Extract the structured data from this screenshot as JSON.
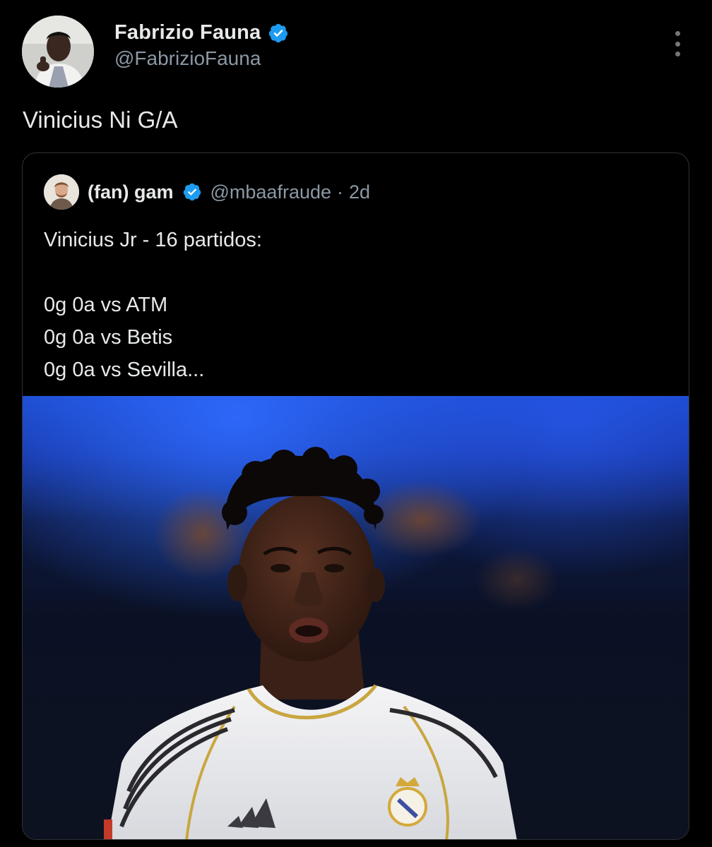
{
  "tweet": {
    "author": {
      "display_name": "Fabrizio Fauna",
      "handle": "@FabrizioFauna",
      "verified": true,
      "avatar_icon": "profile-photo"
    },
    "text": "Vinicius Ni G/A"
  },
  "quoted_tweet": {
    "author": {
      "display_name": "(fan) gam",
      "handle": "@mbaafraude",
      "verified": true,
      "avatar_icon": "profile-photo"
    },
    "separator": "·",
    "time": "2d",
    "lines": [
      "Vinicius Jr - 16 partidos:",
      "",
      "0g 0a vs ATM",
      "0g 0a vs Betis",
      "0g 0a vs Sevilla..."
    ],
    "media_icon": "football-player-photo"
  },
  "colors": {
    "background": "#000000",
    "text_primary": "#e7e9ea",
    "text_secondary": "#8b98a5",
    "border": "#2f3336",
    "verified": "#1d9bf0"
  }
}
